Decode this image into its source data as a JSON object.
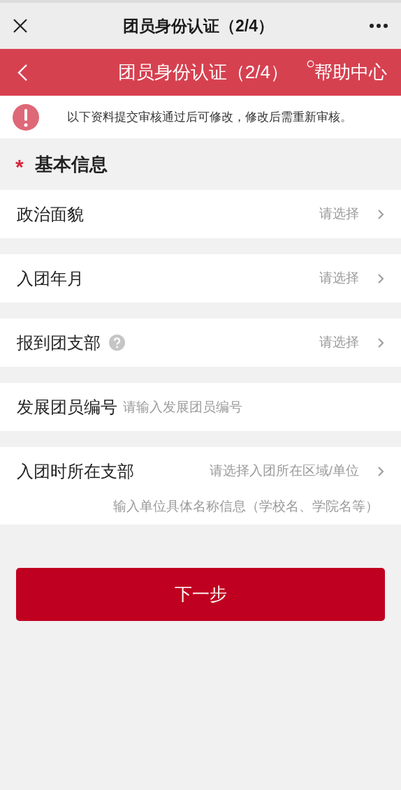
{
  "top_bar": {
    "title": "团员身份认证（2/4）"
  },
  "header": {
    "title": "团员身份认证（2/4）",
    "help_link": "帮助中心"
  },
  "notice": {
    "text": "以下资料提交审核通过后可修改，修改后需重新审核。"
  },
  "section": {
    "required_mark": "*",
    "title": "基本信息"
  },
  "rows": [
    {
      "kind": "select",
      "label": "政治面貌",
      "placeholder": "请选择",
      "help": false
    },
    {
      "kind": "select",
      "label": "入团年月",
      "placeholder": "请选择",
      "help": false
    },
    {
      "kind": "select",
      "label": "报到团支部",
      "placeholder": "请选择",
      "help": true
    },
    {
      "kind": "input",
      "label": "发展团员编号",
      "placeholder": "请输入发展团员编号",
      "help": false
    },
    {
      "kind": "select",
      "label": "入团时所在支部",
      "placeholder": "请选择入团所在区域/单位",
      "help": false,
      "detail_placeholder": "输入单位具体名称信息（学校名、学院名等）"
    }
  ],
  "next_button": "下一步"
}
